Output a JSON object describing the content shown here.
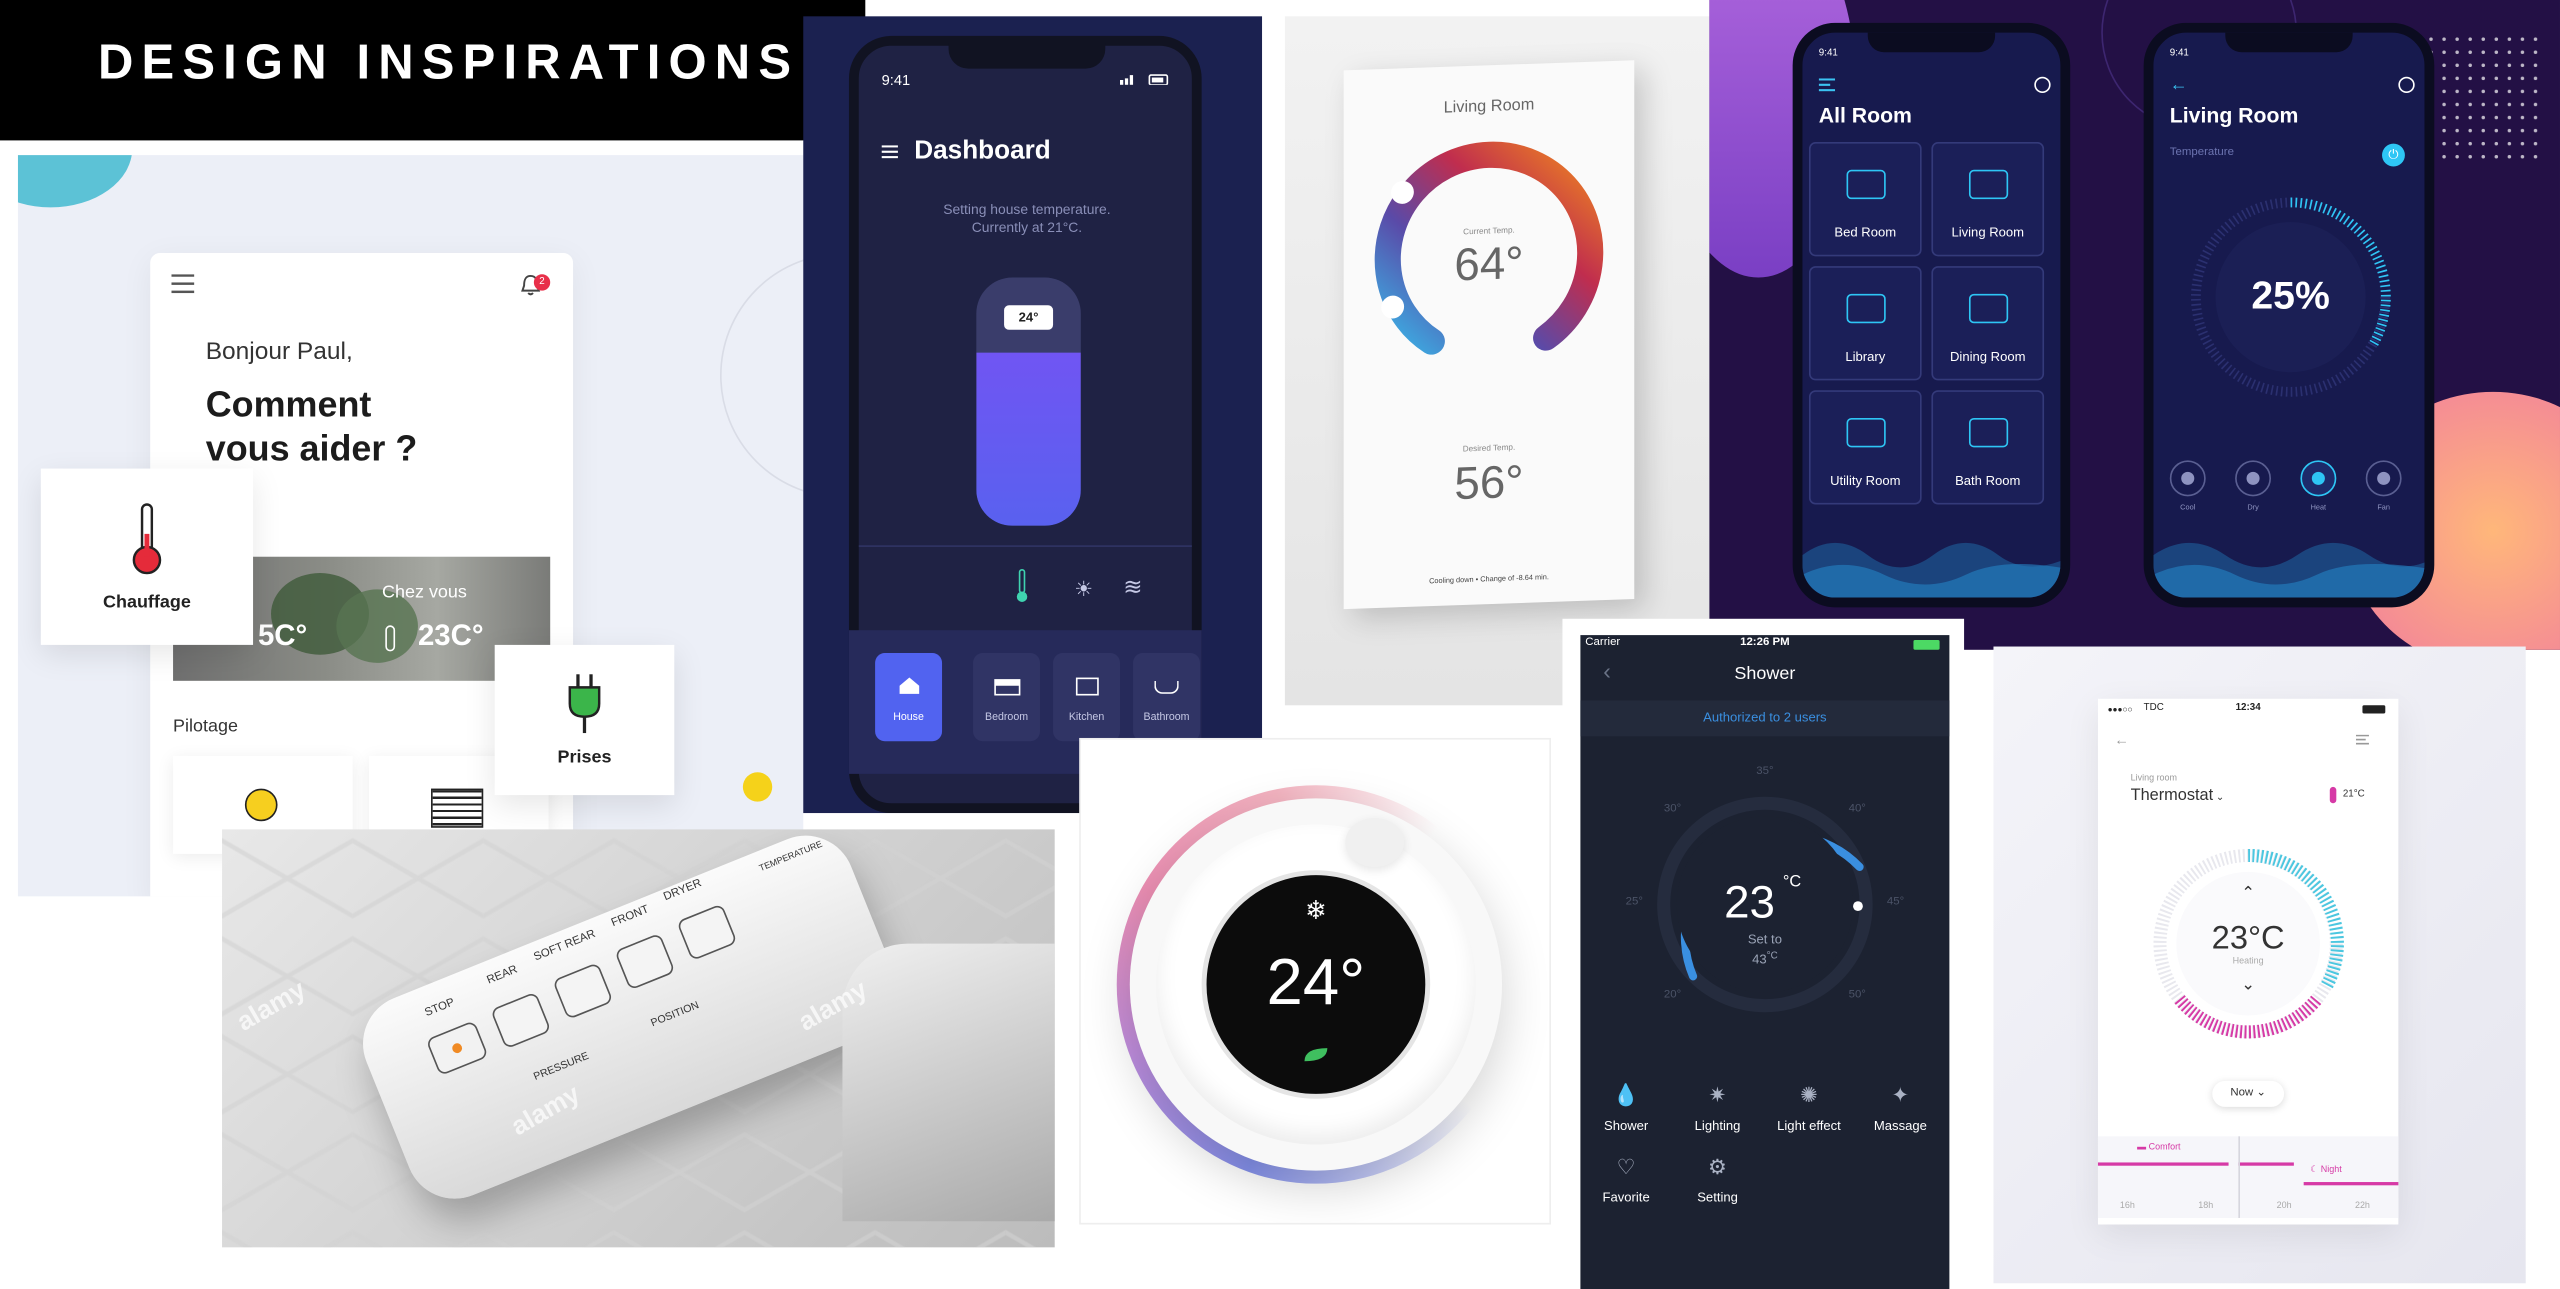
{
  "banner": {
    "title": "DESIGN INSPIRATIONS"
  },
  "french_app": {
    "greeting": "Bonjour Paul,",
    "headline_line1": "Comment",
    "headline_line2": "vous aider ?",
    "notification_count": "2",
    "card_chauffage": "Chauffage",
    "card_prises": "Prises",
    "chez_vous_label": "Chez vous",
    "outside_temp": "5C°",
    "inside_temp": "23C°",
    "pilotage_label": "Pilotage"
  },
  "dashboard_app": {
    "status_time": "9:41",
    "title": "Dashboard",
    "subtitle_line1": "Setting house temperature.",
    "subtitle_line2": "Currently at 21°C.",
    "slider_value": "24°",
    "slider_level": 0.7,
    "rooms": [
      "House",
      "Bedroom",
      "Kitchen",
      "Bathroom"
    ]
  },
  "wall_thermostat": {
    "room": "Living Room",
    "current_label": "Current Temp.",
    "current_temp": "64°",
    "desired_label": "Desired Temp.",
    "desired_temp": "56°",
    "footer": "Cooling down • Change of -8.64 min."
  },
  "purple_app": {
    "status_time_left": "9:41",
    "status_time_right": "9:41",
    "left_title": "All Room",
    "rooms": [
      "Bed Room",
      "Living Room",
      "Library",
      "Dining Room",
      "Utility Room",
      "Bath Room"
    ],
    "right_title": "Living Room",
    "temperature_label": "Temperature",
    "percent": "25%",
    "modes": [
      "Cool",
      "Dry",
      "Heat",
      "Fan"
    ],
    "accent": "#2ec6f5"
  },
  "shower_app": {
    "carrier": "Carrier",
    "time": "12:26 PM",
    "title": "Shower",
    "authorized": "Authorized to 2 users",
    "temp": "23",
    "temp_unit": "°C",
    "set_to_label": "Set to",
    "set_to_value": "43",
    "set_to_unit": "°C",
    "scale_ticks": [
      "20°",
      "25°",
      "30°",
      "35°",
      "40°",
      "45°",
      "50°"
    ],
    "features_row1": [
      "Shower",
      "Lighting",
      "Light effect",
      "Massage"
    ],
    "features_row2": [
      "Favorite",
      "Setting"
    ],
    "accent": "#3a8fe0"
  },
  "round_thermostat": {
    "temp": "24°"
  },
  "white_thermostat_app": {
    "carrier": "TDC",
    "time": "12:34",
    "room_label": "Living room",
    "device": "Thermostat",
    "room_temp": "21°C",
    "temp": "23°C",
    "mode": "Heating",
    "now_button": "Now",
    "comfort_label": "Comfort",
    "night_label": "Night",
    "hours": [
      "16h",
      "18h",
      "20h",
      "22h"
    ],
    "accent_pink": "#d63aa6",
    "accent_blue": "#4bc7e0"
  },
  "toilet_panel": {
    "buttons": [
      "STOP",
      "REAR",
      "SOFT REAR",
      "FRONT",
      "DRYER"
    ],
    "pressure_label": "PRESSURE",
    "position_label": "POSITION",
    "temperature_label": "TEMPERATURE",
    "watermark": "alamy"
  }
}
